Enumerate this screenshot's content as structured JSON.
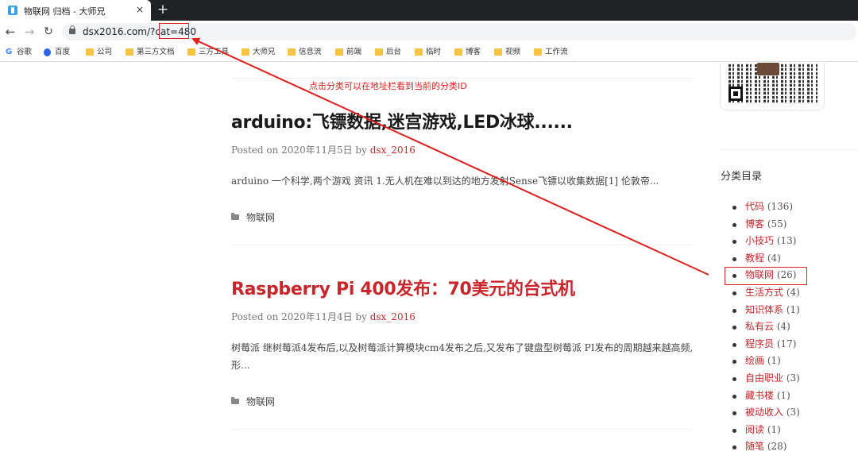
{
  "browser": {
    "tab_title": "物联网 归档 - 大师兄",
    "tab_close": "×",
    "new_tab": "+",
    "url": "dsx2016.com/?cat=480",
    "icons": [
      "back-icon",
      "forward-icon",
      "reload-icon",
      "lock-icon"
    ]
  },
  "bookmarks": [
    {
      "label": "谷歌",
      "icon": "google-icon"
    },
    {
      "label": "百度",
      "icon": "baidu-icon"
    },
    {
      "label": "公司",
      "icon": "folder-icon"
    },
    {
      "label": "第三方文档",
      "icon": "folder-icon"
    },
    {
      "label": "三方工具",
      "icon": "folder-icon"
    },
    {
      "label": "大师兄",
      "icon": "folder-icon"
    },
    {
      "label": "信息流",
      "icon": "folder-icon"
    },
    {
      "label": "前端",
      "icon": "folder-icon"
    },
    {
      "label": "后台",
      "icon": "folder-icon"
    },
    {
      "label": "临时",
      "icon": "folder-icon"
    },
    {
      "label": "博客",
      "icon": "folder-icon"
    },
    {
      "label": "视频",
      "icon": "folder-icon"
    },
    {
      "label": "工作流",
      "icon": "folder-icon"
    }
  ],
  "annotation": {
    "text": "点击分类可以在地址栏看到当前的分类ID",
    "color": "#e02020"
  },
  "posts": [
    {
      "title": "arduino:飞镖数据,迷宫游戏,LED冰球......",
      "title_color": "#1a1a1a",
      "meta_prefix": "Posted on 2020年11月5日 by ",
      "author": "dsx_2016",
      "excerpt": "arduino 一个科学,两个游戏 资讯 1.无人机在难以到达的地方发射Sense飞镖以收集数据[1] 伦敦帝...",
      "category": "物联网"
    },
    {
      "title": "Raspberry Pi 400发布：70美元的台式机",
      "title_color": "#c9252b",
      "meta_prefix": "Posted on 2020年11月4日 by ",
      "author": "dsx_2016",
      "excerpt": "树莓派 继树莓派4发布后,以及树莓派计算模块cm4发布之后,又发布了键盘型树莓派 PI发布的周期越来越高频,形...",
      "category": "物联网"
    }
  ],
  "sidebar": {
    "heading": "分类目录",
    "categories": [
      {
        "name": "代码",
        "count": "(136)"
      },
      {
        "name": "博客",
        "count": "(55)"
      },
      {
        "name": "小技巧",
        "count": "(13)"
      },
      {
        "name": "教程",
        "count": "(4)"
      },
      {
        "name": "物联网",
        "count": "(26)"
      },
      {
        "name": "生活方式",
        "count": "(4)"
      },
      {
        "name": "知识体系",
        "count": "(1)"
      },
      {
        "name": "私有云",
        "count": "(4)"
      },
      {
        "name": "程序员",
        "count": "(17)"
      },
      {
        "name": "绘画",
        "count": "(1)"
      },
      {
        "name": "自由职业",
        "count": "(3)"
      },
      {
        "name": "藏书楼",
        "count": "(1)"
      },
      {
        "name": "被动收入",
        "count": "(3)"
      },
      {
        "name": "阅读",
        "count": "(1)"
      },
      {
        "name": "随笔",
        "count": "(28)"
      }
    ]
  },
  "colors": {
    "link": "#c9252b",
    "annotation": "#e02020",
    "chrome_dark": "#202124"
  }
}
